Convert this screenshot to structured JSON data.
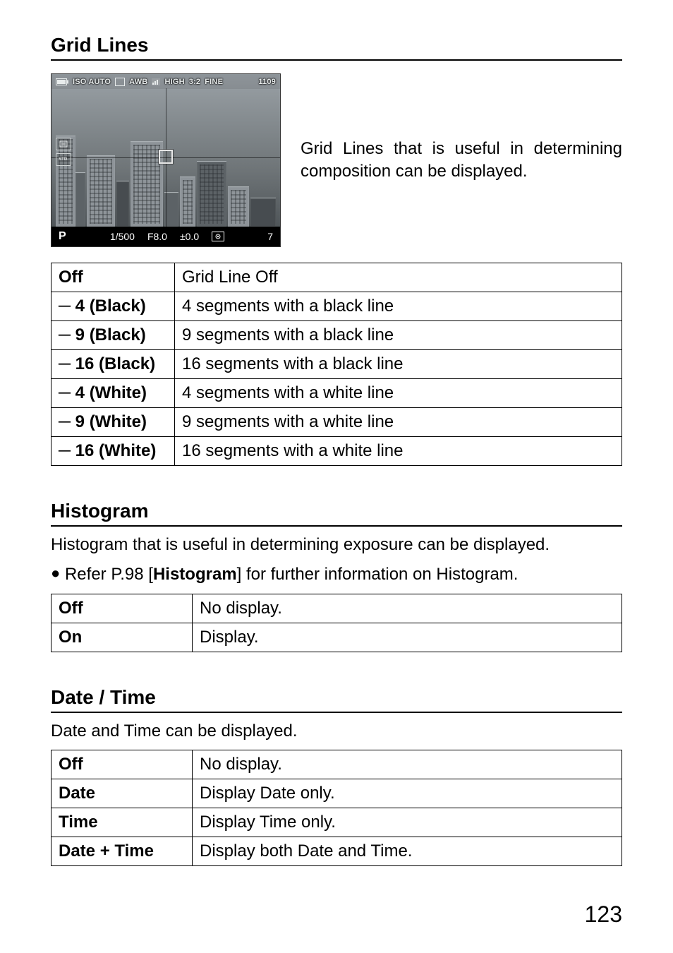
{
  "page_number": "123",
  "sections": {
    "grid_lines": {
      "title": "Grid Lines",
      "intro": "Grid Lines that is useful in determining composition can be displayed.",
      "table": [
        {
          "key": "Off",
          "val": "Grid Line Off"
        },
        {
          "key": "─ 4 (Black)",
          "val": "4 segments with a black line"
        },
        {
          "key": "─ 9 (Black)",
          "val": "9 segments with a black line"
        },
        {
          "key": "─ 16 (Black)",
          "val": "16 segments with a black line"
        },
        {
          "key": "─ 4 (White)",
          "val": "4 segments with a white line"
        },
        {
          "key": "─ 9 (White)",
          "val": "9 segments with a white line"
        },
        {
          "key": "─ 16 (White)",
          "val": "16 segments with a white line"
        }
      ]
    },
    "histogram": {
      "title": "Histogram",
      "intro": "Histogram that is useful in determining exposure can be displayed.",
      "bullet_pre": "Refer P.98 [",
      "bullet_bold": "Histogram",
      "bullet_post": "] for further information on Histogram.",
      "table": [
        {
          "key": "Off",
          "val": "No display."
        },
        {
          "key": "On",
          "val": "Display."
        }
      ]
    },
    "date_time": {
      "title": "Date / Time",
      "intro": "Date and Time can be displayed.",
      "table": [
        {
          "key": "Off",
          "val": "No display."
        },
        {
          "key": "Date",
          "val": "Display Date only."
        },
        {
          "key": "Time",
          "val": "Display Time only."
        },
        {
          "key": "Date + Time",
          "val": "Display both Date and Time."
        }
      ]
    }
  },
  "lcd": {
    "top": {
      "iso": "ISO AUTO",
      "drive_icon": "M",
      "wb": "AWB",
      "nr": "HIGH",
      "aspect": "3:2",
      "quality": "FINE",
      "shots": "1109"
    },
    "left": {
      "badge1": "⌂",
      "badge2": "STD."
    },
    "bottom": {
      "mode": "P",
      "shutter": "1/500",
      "aperture": "F8.0",
      "exp_comp": "±0.0",
      "bracket": "7"
    }
  }
}
